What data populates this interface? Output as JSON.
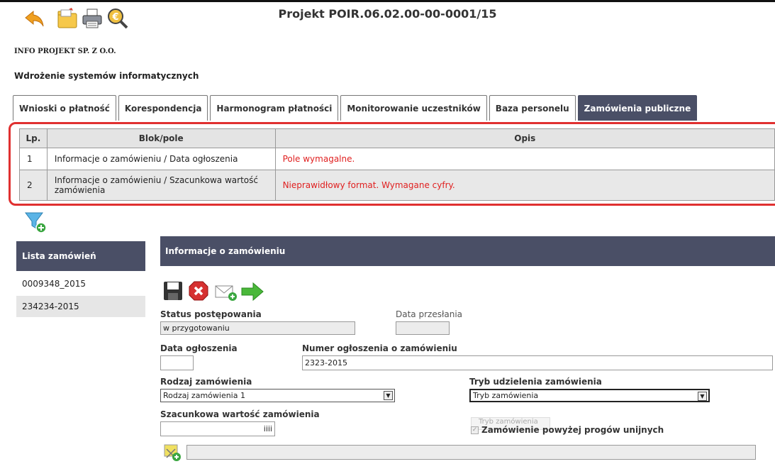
{
  "header": {
    "title": "Projekt POIR.06.02.00-00-0001/15",
    "organization": "INFO PROJEKT SP. Z O.O.",
    "project_name": "Wdrożenie systemów informatycznych",
    "toolbar_icons": [
      "back-arrow-icon",
      "folder-icon",
      "printer-icon",
      "euro-search-icon"
    ]
  },
  "tabs": [
    {
      "label": "Wnioski o płatność",
      "active": false
    },
    {
      "label": "Korespondencja",
      "active": false
    },
    {
      "label": "Harmonogram płatności",
      "active": false
    },
    {
      "label": "Monitorowanie uczestników",
      "active": false
    },
    {
      "label": "Baza personelu",
      "active": false
    },
    {
      "label": "Zamówienia publiczne",
      "active": true
    }
  ],
  "errors": {
    "columns": [
      "Lp.",
      "Blok/pole",
      "Opis"
    ],
    "rows": [
      {
        "lp": "1",
        "field": "Informacje o zamówieniu / Data ogłoszenia",
        "desc": "Pole wymagalne."
      },
      {
        "lp": "2",
        "field": "Informacje o zamówieniu / Szacunkowa wartość zamówienia",
        "desc": "Nieprawidłowy format. Wymagane cyfry."
      }
    ]
  },
  "sidebar": {
    "title": "Lista zamówień",
    "items": [
      "0009348_2015",
      "234234-2015"
    ]
  },
  "section": {
    "title": "Informacje o zamówieniu",
    "actions": [
      "save-icon",
      "delete-icon",
      "send-mail-icon",
      "next-arrow-icon"
    ]
  },
  "form": {
    "status_label": "Status postępowania",
    "status_value": "w przygotowaniu",
    "sent_date_label": "Data przesłania",
    "sent_date_value": "",
    "announce_date_label": "Data ogłoszenia",
    "announce_date_value": "",
    "announce_number_label": "Numer ogłoszenia o zamówieniu",
    "announce_number_value": "2323-2015",
    "type_label": "Rodzaj zamówienia",
    "type_value": "Rodzaj zamówienia 1",
    "mode_label": "Tryb udzielenia zamówienia",
    "mode_value": "Tryb zamówienia",
    "mode_tooltip": "Tryb zamówienia",
    "value_label": "Szacunkowa wartość zamówienia",
    "value_value": "iiii",
    "eu_threshold_label": "Zamówienie powyżej progów unijnych",
    "eu_threshold_checked": true,
    "attachment_value": ""
  },
  "colors": {
    "header_bg": "#4a4f66",
    "error_border": "#e03030",
    "error_text": "#e02020"
  }
}
